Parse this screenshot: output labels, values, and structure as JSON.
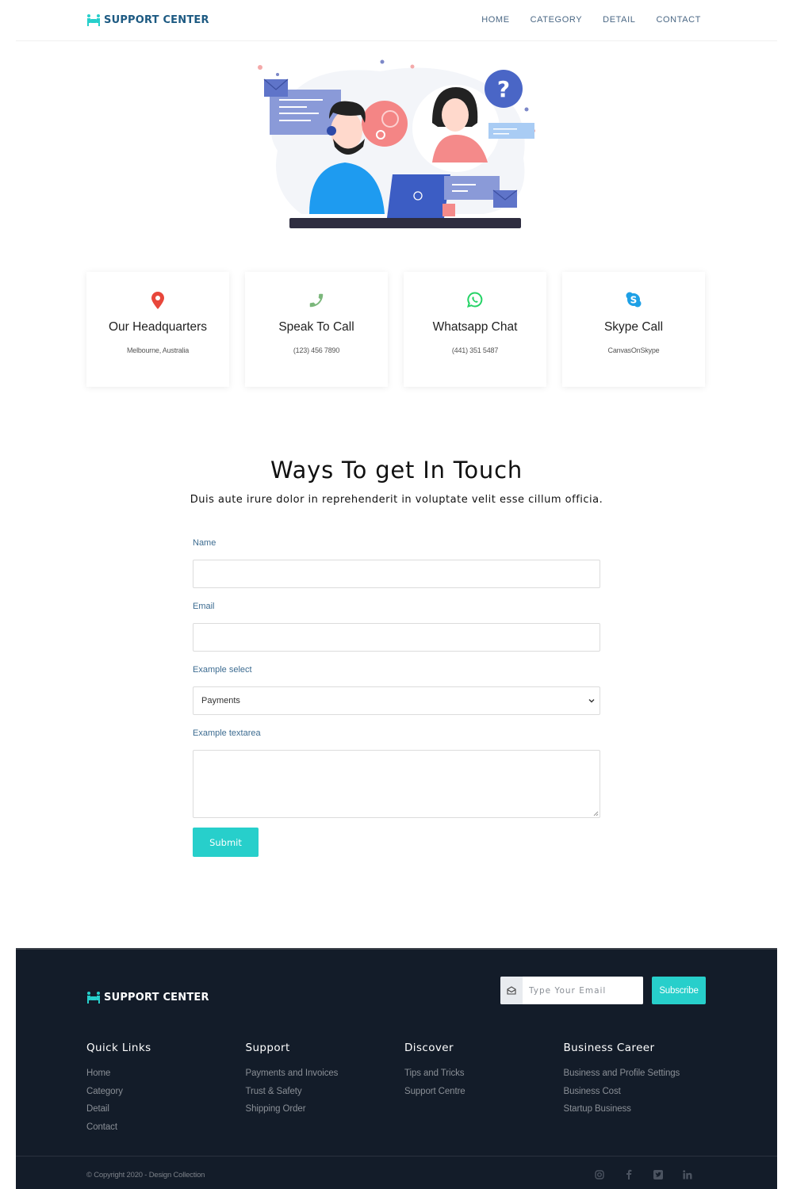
{
  "header": {
    "brand": "SUPPORT CENTER",
    "brand_icon": "team-icon",
    "nav": [
      "HOME",
      "CATEGORY",
      "DETAIL",
      "CONTACT"
    ]
  },
  "hero": {
    "illustration": "customer-support-illustration"
  },
  "cards": [
    {
      "icon": "map-pin-icon",
      "icon_color": "#e8473b",
      "title": "Our Headquarters",
      "sub": "Melbourne, Australia"
    },
    {
      "icon": "phone-icon",
      "icon_color": "#7bb77b",
      "title": "Speak To Call",
      "sub": "(123) 456 7890"
    },
    {
      "icon": "whatsapp-icon",
      "icon_color": "#25d366",
      "title": "Whatsapp Chat",
      "sub": "(441) 351 5487"
    },
    {
      "icon": "skype-icon",
      "icon_color": "#1ea0e6",
      "title": "Skype Call",
      "sub": "CanvasOnSkype"
    }
  ],
  "contact": {
    "title": "Ways To get In Touch",
    "subtitle": "Duis aute irure dolor in reprehenderit in voluptate velit esse cillum officia.",
    "form": {
      "name_label": "Name",
      "name_value": "",
      "email_label": "Email",
      "email_value": "",
      "select_label": "Example select",
      "select_value": "Payments",
      "textarea_label": "Example textarea",
      "textarea_value": "",
      "submit_label": "Submit"
    }
  },
  "footer": {
    "brand": "SUPPORT CENTER",
    "subscribe": {
      "placeholder": "Type Your Email",
      "button_label": "Subscribe"
    },
    "columns": [
      {
        "title": "Quick Links",
        "links": [
          "Home",
          "Category",
          "Detail",
          "Contact"
        ]
      },
      {
        "title": "Support",
        "links": [
          "Payments and Invoices",
          "Trust & Safety",
          "Shipping Order"
        ]
      },
      {
        "title": "Discover",
        "links": [
          "Tips and Tricks",
          "Support Centre"
        ]
      },
      {
        "title": "Business Career",
        "links": [
          "Business and Profile Settings",
          "Business Cost",
          "Startup Business"
        ]
      }
    ],
    "copyright": "© Copyright 2020 - Design Collection",
    "social": [
      "instagram-icon",
      "facebook-icon",
      "twitter-icon",
      "linkedin-icon"
    ]
  },
  "colors": {
    "brand": "#1d5a82",
    "accent": "#27cfcb",
    "footer_bg": "#131c29",
    "label": "#3d6c91"
  }
}
